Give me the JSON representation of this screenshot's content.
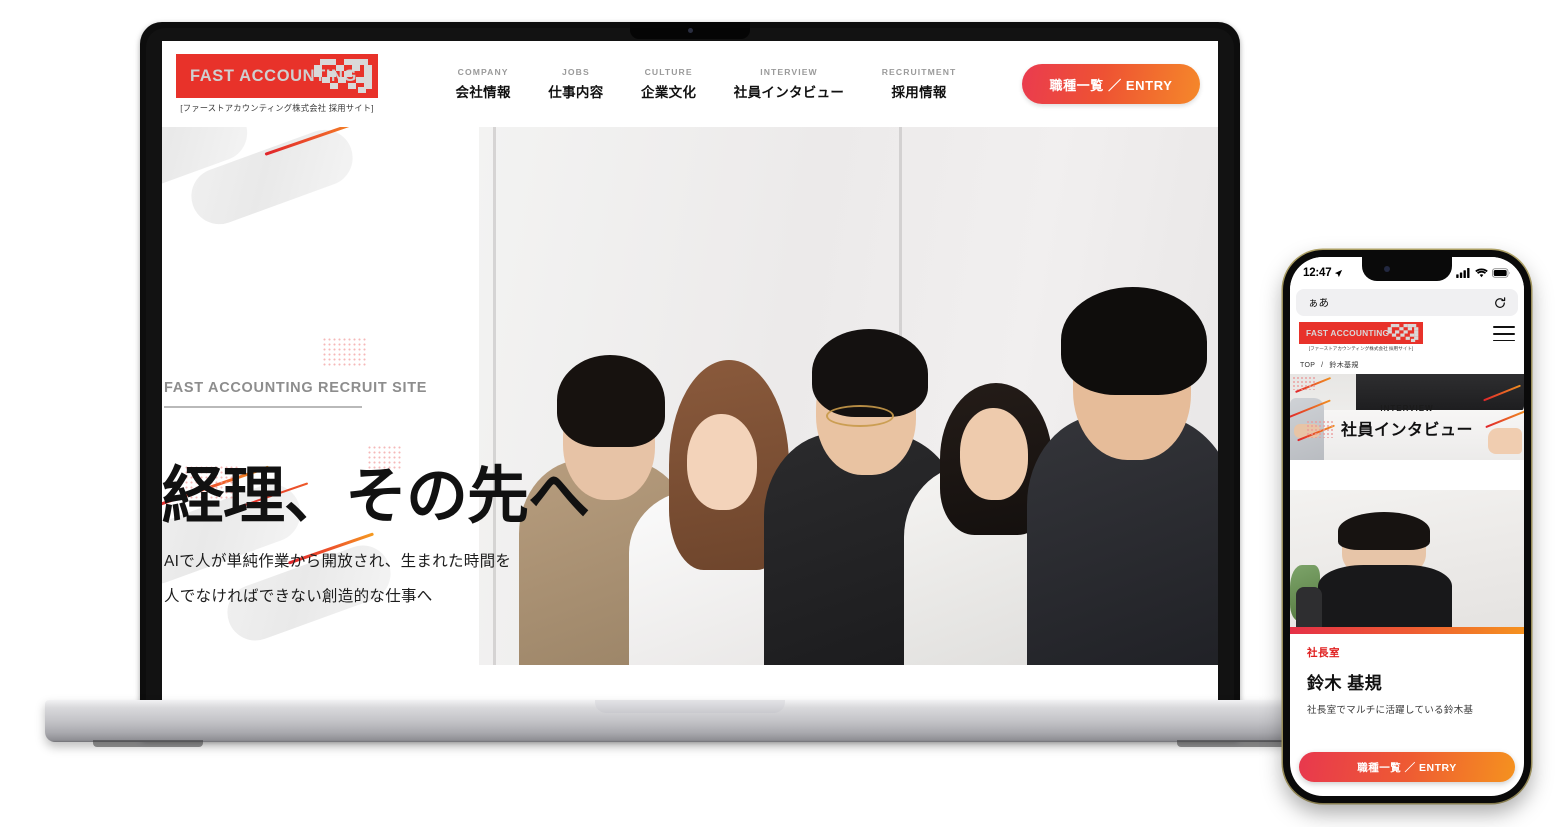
{
  "laptop": {
    "site": {
      "logo": {
        "brand": "FAST ACCOUNTING",
        "subtitle": "[ファーストアカウンティング株式会社 採用サイト]"
      },
      "nav": [
        {
          "en": "COMPANY",
          "ja": "会社情報"
        },
        {
          "en": "JOBS",
          "ja": "仕事内容"
        },
        {
          "en": "CULTURE",
          "ja": "企業文化"
        },
        {
          "en": "INTERVIEW",
          "ja": "社員インタビュー"
        },
        {
          "en": "RECRUITMENT",
          "ja": "採用情報"
        }
      ],
      "entry_button": "職種一覧 ／ ENTRY",
      "hero": {
        "kicker": "FAST ACCOUNTING RECRUIT SITE",
        "headline": "経理、その先へ",
        "lead_line1": "AIで人が単純作業から開放され、生まれた時間を",
        "lead_line2": "人でなければできない創造的な仕事へ"
      }
    }
  },
  "phone": {
    "status": {
      "time": "12:47"
    },
    "safari": {
      "reader_label": "ぁあ",
      "reload_icon": "reload-icon"
    },
    "logo": {
      "brand": "FAST ACCOUNTING",
      "subtitle": "[ファーストアカウンティング株式会社 採用サイト]"
    },
    "breadcrumb": {
      "home": "TOP",
      "separator": "/",
      "current": "鈴木基規"
    },
    "banner": {
      "en": "INTERVIEW",
      "ja": "社員インタビュー"
    },
    "card": {
      "department": "社長室",
      "name": "鈴木 基規",
      "description": "社長室でマルチに活躍している鈴木基"
    },
    "entry_button": "職種一覧 ／ ENTRY"
  },
  "colors": {
    "brand_red": "#e8322a",
    "gradient_start": "#e8384e",
    "gradient_end": "#f5921f",
    "text_dark": "#111111",
    "muted": "#9a9a9a"
  }
}
